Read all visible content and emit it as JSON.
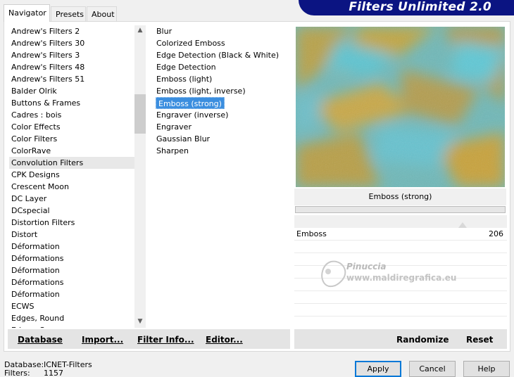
{
  "tabs": [
    {
      "label": "Navigator"
    },
    {
      "label": "Presets"
    },
    {
      "label": "About"
    }
  ],
  "banner_title": "Filters Unlimited 2.0",
  "categories": [
    "Andrew's Filters 2",
    "Andrew's Filters 30",
    "Andrew's Filters 3",
    "Andrew's Filters 48",
    "Andrew's Filters 51",
    "Balder Olrik",
    "Buttons & Frames",
    "Cadres : bois",
    "Color Effects",
    "Color Filters",
    "ColorRave",
    "Convolution Filters",
    "CPK Designs",
    "Crescent Moon",
    "DC Layer",
    "DCspecial",
    "Distortion Filters",
    "Distort",
    "Déformation",
    "Déformations",
    "Déformation",
    "Déformations",
    "Déformation",
    "ECWS",
    "Edges, Round",
    "Edges, Square"
  ],
  "selected_category": "Convolution Filters",
  "filters": [
    "Blur",
    "Colorized Emboss",
    "Edge Detection (Black & White)",
    "Edge Detection",
    "Emboss (light)",
    "Emboss (light, inverse)",
    "Emboss (strong)",
    "Engraver (inverse)",
    "Engraver",
    "Gaussian Blur",
    "Sharpen"
  ],
  "selected_filter": "Emboss (strong)",
  "preview_label": "Emboss (strong)",
  "parameter": {
    "name": "Emboss",
    "value": "206"
  },
  "watermark": {
    "name": "Pinuccia",
    "site": "www.maldiregrafica.eu"
  },
  "left_buttons": {
    "database": "Database",
    "import": "Import...",
    "filter_info": "Filter Info...",
    "editor": "Editor..."
  },
  "right_buttons": {
    "randomize": "Randomize",
    "reset": "Reset"
  },
  "status": {
    "database_label": "Database:",
    "database_value": "ICNET-Filters",
    "filters_label": "Filters:",
    "filters_value": "1157"
  },
  "dialog_buttons": {
    "apply": "Apply",
    "cancel": "Cancel",
    "help": "Help"
  },
  "colors": {
    "banner": "#0b1482",
    "selection": "#3b8edf"
  }
}
